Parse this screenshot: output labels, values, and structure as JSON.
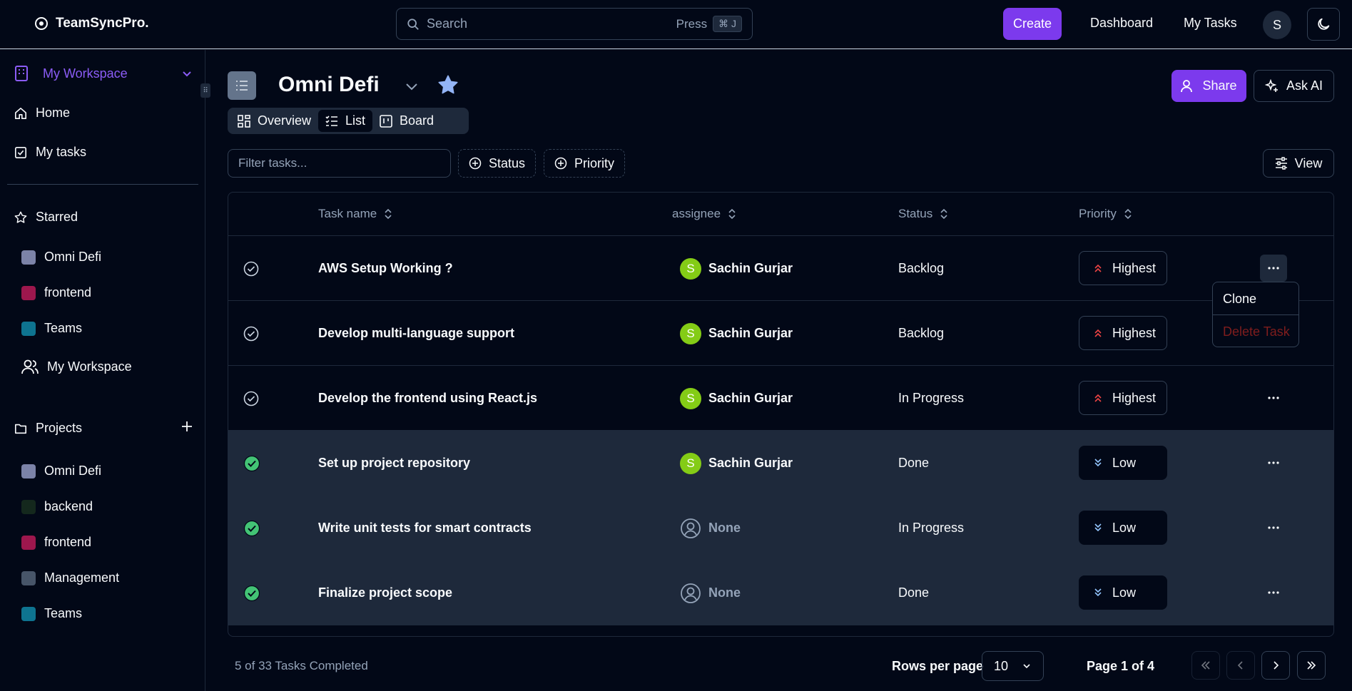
{
  "app": {
    "name": "TeamSyncPro.",
    "search_placeholder": "Search",
    "search_press": "Press",
    "search_shortcut": "⌘ J",
    "create_label": "Create",
    "nav": [
      "Dashboard",
      "My Tasks"
    ],
    "user_initial": "S"
  },
  "sidebar": {
    "workspace": "My Workspace",
    "items": [
      {
        "label": "Home",
        "icon": "home-icon"
      },
      {
        "label": "My tasks",
        "icon": "checkbox-icon"
      }
    ],
    "starred_label": "Starred",
    "starred": [
      {
        "label": "Omni Defi",
        "color": "#7c83a8"
      },
      {
        "label": "frontend",
        "color": "#9d174d"
      },
      {
        "label": "Teams",
        "color": "#0e7490"
      }
    ],
    "starred_workspace": "My Workspace",
    "projects_label": "Projects",
    "projects": [
      {
        "label": "Omni Defi",
        "color": "#7c83a8"
      },
      {
        "label": "backend",
        "color": "#14281d"
      },
      {
        "label": "frontend",
        "color": "#9d174d"
      },
      {
        "label": "Management",
        "color": "#475569"
      },
      {
        "label": "Teams",
        "color": "#0e7490"
      }
    ]
  },
  "project": {
    "title": "Omni Defi",
    "share_label": "Share",
    "ask_ai_label": "Ask AI",
    "tabs": [
      {
        "label": "Overview",
        "active": false
      },
      {
        "label": "List",
        "active": true
      },
      {
        "label": "Board",
        "active": false
      }
    ]
  },
  "toolbar": {
    "filter_placeholder": "Filter tasks...",
    "status_label": "Status",
    "priority_label": "Priority",
    "view_label": "View"
  },
  "table": {
    "headers": {
      "task": "Task name",
      "assignee": "assignee",
      "status": "Status",
      "priority": "Priority"
    },
    "rows": [
      {
        "task": "AWS Setup Working ?",
        "assignee": "Sachin Gurjar",
        "avatar": "S",
        "status": "Backlog",
        "priority": "Highest",
        "done": false
      },
      {
        "task": "Develop multi-language support",
        "assignee": "Sachin Gurjar",
        "avatar": "S",
        "status": "Backlog",
        "priority": "Highest",
        "done": false
      },
      {
        "task": "Develop the frontend using React.js",
        "assignee": "Sachin Gurjar",
        "avatar": "S",
        "status": "In Progress",
        "priority": "Highest",
        "done": false
      },
      {
        "task": "Set up project repository",
        "assignee": "Sachin Gurjar",
        "avatar": "S",
        "status": "Done",
        "priority": "Low",
        "done": true
      },
      {
        "task": "Write unit tests for smart contracts",
        "assignee": "None",
        "avatar": "",
        "status": "In Progress",
        "priority": "Low",
        "done": true
      },
      {
        "task": "Finalize project scope",
        "assignee": "None",
        "avatar": "",
        "status": "Done",
        "priority": "Low",
        "done": true
      }
    ]
  },
  "row_menu": {
    "clone_label": "Clone",
    "delete_label": "Delete Task"
  },
  "footer": {
    "completed_text": "5 of 33 Tasks Completed",
    "rows_per_page_label": "Rows per page",
    "rows_per_page_value": "10",
    "page_text": "Page 1 of 4"
  },
  "colors": {
    "accent": "#7c3aed",
    "background": "#020817",
    "highest": "#ef4444",
    "done_check": "#4ade80"
  }
}
